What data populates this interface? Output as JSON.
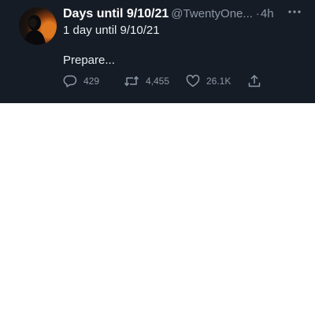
{
  "tweet": {
    "display_name": "Days until 9/10/21",
    "handle": "@TwentyOne...",
    "separator": "·",
    "timestamp": "4h",
    "text_line1": "1 day until 9/10/21",
    "text_line2": "Prepare...",
    "more_icon": "more-horizontal-icon",
    "stats": {
      "replies": "429",
      "retweets": "4,455",
      "likes": "26.1K"
    },
    "icons": {
      "reply": "reply-bubble-icon",
      "retweet": "retweet-arrows-icon",
      "like": "heart-icon",
      "share": "share-upload-icon"
    }
  },
  "colors": {
    "card_background": "#161c26",
    "primary_text": "#ffffff",
    "secondary_text": "#8b98a5",
    "page_background": "#ffffff"
  }
}
